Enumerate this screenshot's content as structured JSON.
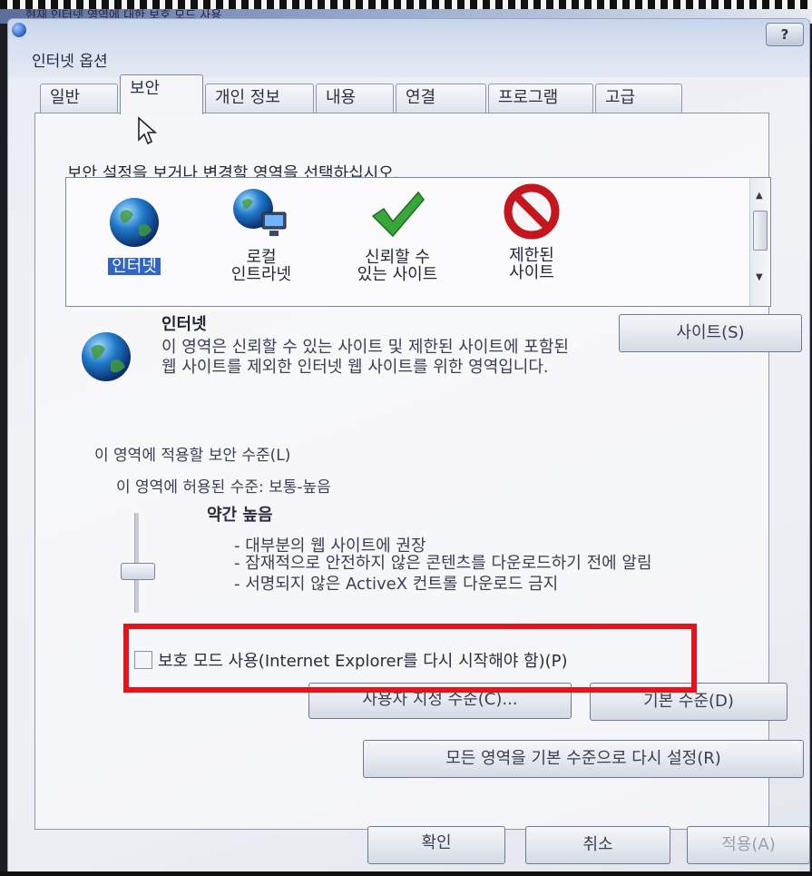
{
  "window": {
    "behind_title": "현재 인터넷 영역에 대한 보호 모드 사용",
    "title": "인터넷 옵션",
    "help_label": "?"
  },
  "tabs": [
    {
      "label": "일반"
    },
    {
      "label": "보안",
      "active": true
    },
    {
      "label": "개인 정보"
    },
    {
      "label": "내용"
    },
    {
      "label": "연결"
    },
    {
      "label": "프로그램"
    },
    {
      "label": "고급"
    }
  ],
  "security": {
    "instruction": "보안 설정을 보거나 변경할 영역을 선택하십시오.",
    "zones": [
      {
        "icon": "globe-icon",
        "label": "인터넷",
        "selected": true
      },
      {
        "icon": "local-intranet-icon",
        "label_line1": "로컬",
        "label_line2": "인트라넷"
      },
      {
        "icon": "checkmark-icon",
        "label_line1": "신뢰할 수",
        "label_line2": "있는 사이트"
      },
      {
        "icon": "prohibited-icon",
        "label_line1": "제한된",
        "label_line2": "사이트"
      }
    ],
    "selected_zone": {
      "name": "인터넷",
      "description": "이 영역은 신뢰할 수 있는 사이트 및 제한된 사이트에 포함된 웹 사이트를 제외한 인터넷 웹 사이트를 위한 영역입니다."
    },
    "sites_button": "사이트(S)",
    "level_label": "이 영역에 적용할 보안 수준(L)",
    "allowed_level": "이 영역에 허용된 수준: 보통-높음",
    "level_name": "약간 높음",
    "level_points": [
      "- 대부분의 웹 사이트에 권장",
      "- 잠재적으로 안전하지 않은 콘텐츠를 다운로드하기 전에 알림",
      "- 서명되지 않은 ActiveX 컨트롤 다운로드 금지"
    ],
    "slider_level_fraction": 0.6,
    "protected_mode_label": "보호 모드 사용(Internet Explorer를 다시 시작해야 함)(P)",
    "protected_mode_checked": false,
    "custom_level_button": "사용자 지정 수준(C)...",
    "default_level_button": "기본 수준(D)",
    "reset_all_button": "모든 영역을 기본 수준으로 다시 설정(R)"
  },
  "footer": {
    "ok": "확인",
    "cancel": "취소",
    "apply": "적용(A)"
  },
  "colors": {
    "highlight": "#e5141a",
    "selection": "#3065c8"
  }
}
